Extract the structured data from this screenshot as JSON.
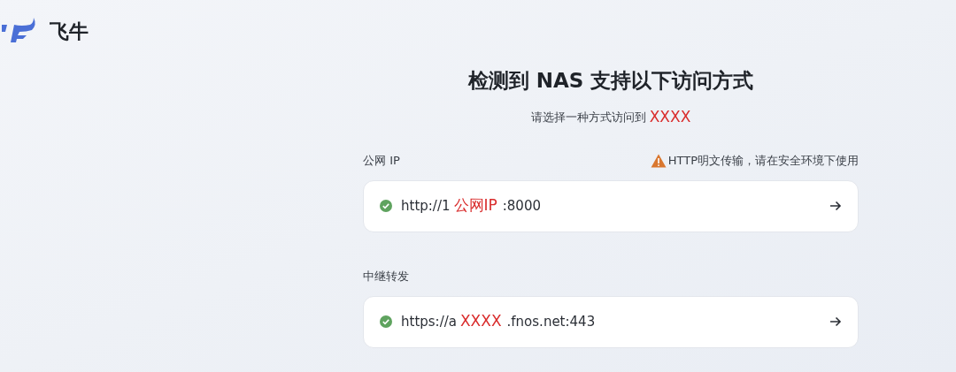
{
  "brand": {
    "name": "飞牛"
  },
  "title": "检测到 NAS 支持以下访问方式",
  "subtitle": {
    "text": "请选择一种方式访问到",
    "redaction": "XXXX"
  },
  "methods": [
    {
      "label": "公网 IP",
      "warning": "HTTP明文传输，请在安全环境下使用",
      "url_prefix": "http://1",
      "redaction": "公网IP",
      "url_suffix": ":8000"
    },
    {
      "label": "中继转发",
      "url_prefix": "https://a",
      "redaction": "XXXX",
      "url_suffix": ".fnos.net:443"
    }
  ]
}
